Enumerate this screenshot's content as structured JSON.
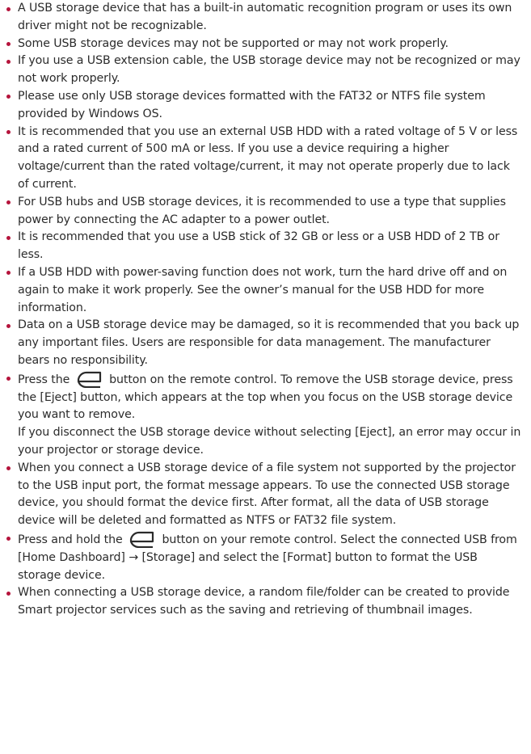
{
  "colors": {
    "bullet": "#b5143c",
    "text": "#2b2b2b"
  },
  "notes": [
    "A USB storage device that has a built-in automatic recognition program or uses its own driver might not be recognizable.",
    "Some USB storage devices may not be supported or may not work properly.",
    "If you use a USB extension cable, the USB storage device may not be recognized or may not work properly.",
    "Please use only USB storage devices formatted with the FAT32 or NTFS file system provided by Windows OS.",
    "It is recommended that you use an external USB HDD with a rated voltage of 5 V or less and a rated current of 500 mA or less. If you use a device requiring a higher voltage/current than the rated voltage/current, it may not operate properly due to lack of current.",
    "For USB hubs and USB storage devices, it is recommended to use a type that supplies power by connecting the AC adapter to a power outlet.",
    "It is recommended that you use a USB stick of 32 GB or less or a USB HDD of 2 TB or less.",
    "If a USB HDD with power-saving function does not work, turn the hard drive off and on again to make it work properly. See the owner’s manual for the USB HDD for more information.",
    "Data on a USB storage device may be damaged, so it is recommended that you back up any important files. Users are responsible for data management. The manufacturer bears no responsibility."
  ],
  "eject_note": {
    "before_icon": "Press the",
    "after_icon": "button on the remote control. To remove the USB storage device, press the [Eject] button, which appears at the top when you focus on the USB storage device you want to remove.",
    "second_paragraph": "If you disconnect the USB storage device without selecting [Eject], an error may occur in your projector or storage device."
  },
  "format_message_note": "When you connect a USB storage device of a file system not supported by the projector to the USB input port, the format message appears. To use the connected USB storage device, you should format the device first. After format, all the data of USB storage device will be deleted and formatted as NTFS or FAT32 file system.",
  "format_note": {
    "before_icon": "Press and hold the",
    "after_icon": "button on your remote control. Select the connected USB from [Home Dashboard] → [Storage] and select the [Format] button to format the USB storage device."
  },
  "random_file_note": "When connecting a USB storage device, a random file/folder can be created to provide Smart projector services such as the saving and retrieving of thumbnail images.",
  "icons": {
    "input_button": "input-source-icon"
  }
}
